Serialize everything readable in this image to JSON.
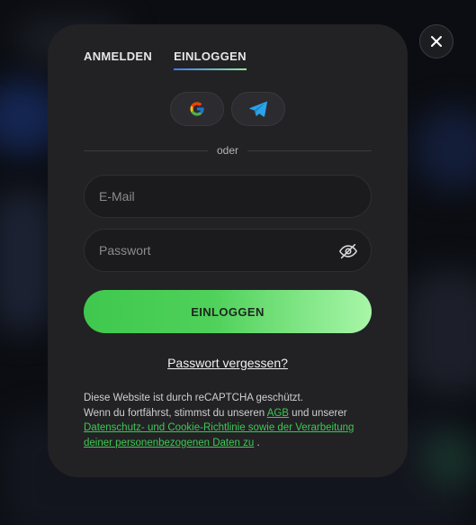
{
  "tabs": {
    "register": "ANMELDEN",
    "login": "EINLOGGEN"
  },
  "divider_text": "oder",
  "form": {
    "email_placeholder": "E-Mail",
    "password_placeholder": "Passwort",
    "submit_label": "EINLOGGEN"
  },
  "forgot_password": "Passwort vergessen?",
  "legal": {
    "line1": "Diese Website ist durch reCAPTCHA geschützt.",
    "line2_prefix": "Wenn du fortfährst, stimmst du unseren ",
    "agb_link": "AGB",
    "line2_mid": " und unserer",
    "privacy_link": "Datenschutz- und Cookie-Richtlinie sowie der Verarbeitung deiner personenbezogenen Daten zu",
    "suffix": " ."
  },
  "colors": {
    "accent_green": "#3dc951",
    "tab_underline_start": "#3d7bf0",
    "tab_underline_end": "#8fe89a",
    "modal_bg": "#222225"
  },
  "icons": {
    "close": "close-icon",
    "google": "google-icon",
    "telegram": "telegram-icon",
    "eye": "eye-slash-icon"
  }
}
